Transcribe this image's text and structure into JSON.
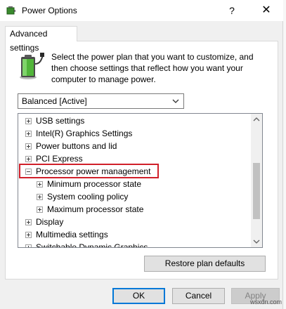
{
  "window": {
    "title": "Power Options",
    "help_glyph": "?",
    "close_glyph": "✕"
  },
  "tab": {
    "label": "Advanced settings"
  },
  "intro": {
    "text": "Select the power plan that you want to customize, and then choose settings that reflect how you want your computer to manage power."
  },
  "plan_select": {
    "value": "Balanced [Active]"
  },
  "tree": {
    "items": [
      {
        "label": "USB settings",
        "expander": "plus"
      },
      {
        "label": "Intel(R) Graphics Settings",
        "expander": "plus"
      },
      {
        "label": "Power buttons and lid",
        "expander": "plus"
      },
      {
        "label": "PCI Express",
        "expander": "plus"
      },
      {
        "label": "Processor power management",
        "expander": "minus",
        "highlighted": true
      },
      {
        "label": "Minimum processor state",
        "expander": "plus",
        "child": true
      },
      {
        "label": "System cooling policy",
        "expander": "plus",
        "child": true
      },
      {
        "label": "Maximum processor state",
        "expander": "plus",
        "child": true
      },
      {
        "label": "Display",
        "expander": "plus"
      },
      {
        "label": "Multimedia settings",
        "expander": "plus"
      },
      {
        "label": "Switchable Dynamic Graphics",
        "expander": "plus"
      }
    ]
  },
  "buttons": {
    "restore": "Restore plan defaults",
    "ok": "OK",
    "cancel": "Cancel",
    "apply": "Apply"
  },
  "watermark": "wsxdn.com",
  "colors": {
    "highlight_border": "#d0202a",
    "default_button_border": "#0078d7",
    "panel_bg": "#ffffff",
    "window_bg": "#f0f0f0"
  },
  "icons": {
    "app": "power-options-icon",
    "plan": "battery-icon",
    "dropdown": "chevron-down-icon"
  }
}
